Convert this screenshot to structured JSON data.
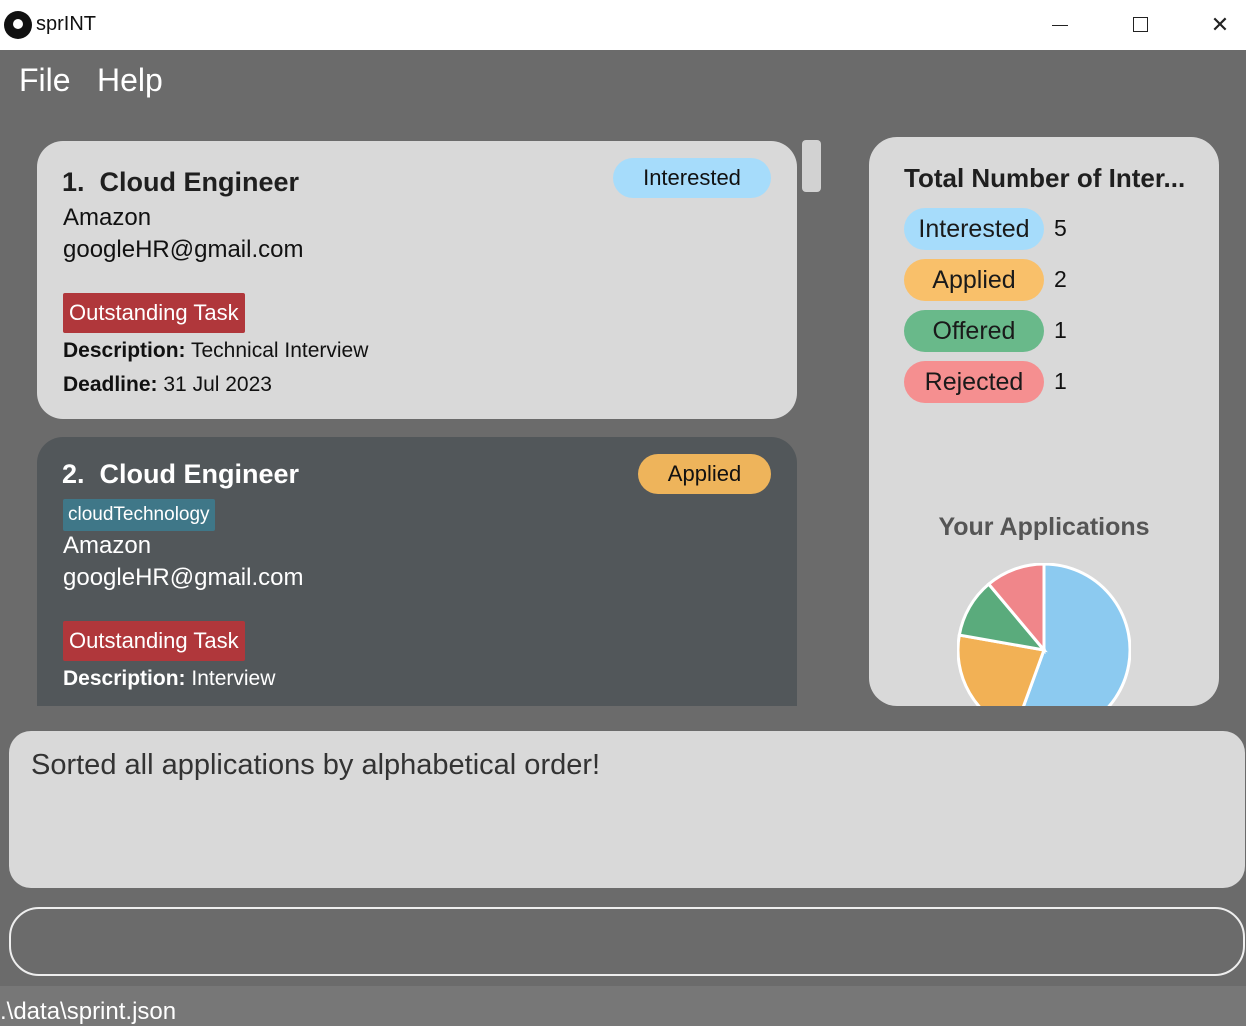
{
  "window": {
    "title": "sprINT"
  },
  "menu": {
    "file": "File",
    "help": "Help"
  },
  "applications": [
    {
      "index": "1.",
      "role": "Cloud Engineer",
      "status": "Interested",
      "company": "Amazon",
      "email": "googleHR@gmail.com",
      "task_label": "Outstanding Task",
      "description_label": "Description:",
      "description": "Technical Interview",
      "deadline_label": "Deadline:",
      "deadline": "31 Jul 2023"
    },
    {
      "index": "2.",
      "role": "Cloud Engineer",
      "status": "Applied",
      "tag": "cloudTechnology",
      "company": "Amazon",
      "email": "googleHR@gmail.com",
      "task_label": "Outstanding Task",
      "description_label": "Description:",
      "description": "Interview"
    }
  ],
  "stats": {
    "title": "Total Number of Inter...",
    "rows": [
      {
        "label": "Interested",
        "count": "5",
        "color": "#a6dcfb"
      },
      {
        "label": "Applied",
        "count": "2",
        "color": "#f9c06a"
      },
      {
        "label": "Offered",
        "count": "1",
        "color": "#69b98a"
      },
      {
        "label": "Rejected",
        "count": "1",
        "color": "#f58f90"
      }
    ],
    "chart_title": "Your Applications"
  },
  "chart_data": {
    "type": "pie",
    "title": "Your Applications",
    "categories": [
      "Interested",
      "Applied",
      "Offered",
      "Rejected"
    ],
    "values": [
      5,
      2,
      1,
      1
    ],
    "colors": [
      "#8ccaf0",
      "#f2b155",
      "#5aab7c",
      "#f0868a"
    ]
  },
  "result": {
    "message": "Sorted all applications by alphabetical order!"
  },
  "command": {
    "value": ""
  },
  "status_bar": {
    "path": ".\\data\\sprint.json"
  }
}
